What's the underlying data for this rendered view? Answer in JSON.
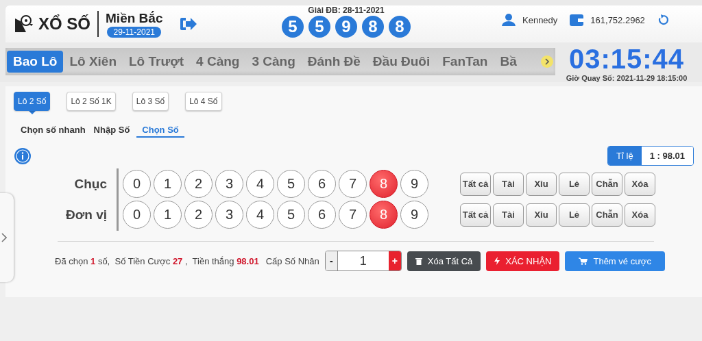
{
  "header": {
    "logo": "XỔ SỐ",
    "region": "Miền Bắc",
    "date": "29-11-2021",
    "jackpot_label": "Giải ĐB: 28-11-2021",
    "jackpot_digits": [
      "5",
      "5",
      "9",
      "8",
      "8"
    ],
    "user": "Kennedy",
    "balance": "161,752.2962"
  },
  "tabs": [
    {
      "label": "Bao Lô",
      "selected": true
    },
    {
      "label": "Lô Xiên",
      "selected": false
    },
    {
      "label": "Lô Trượt",
      "selected": false
    },
    {
      "label": "4 Càng",
      "selected": false
    },
    {
      "label": "3 Càng",
      "selected": false
    },
    {
      "label": "Đánh Đề",
      "selected": false
    },
    {
      "label": "Đầu Đuôi",
      "selected": false
    },
    {
      "label": "FanTan",
      "selected": false
    },
    {
      "label": "Bầ",
      "selected": false
    }
  ],
  "countdown": {
    "time": "03:15:44",
    "draw_time": "Giờ Quay Số: 2021-11-29 18:15:00"
  },
  "bet_types": [
    {
      "label": "Lô 2 Số",
      "selected": true
    },
    {
      "label": "Lô 2 Số 1K",
      "selected": false
    },
    {
      "label": "Lô 3 Số",
      "selected": false
    },
    {
      "label": "Lô 4 Số",
      "selected": false
    }
  ],
  "modes": [
    {
      "label": "Chọn số nhanh",
      "selected": false
    },
    {
      "label": "Nhập Số",
      "selected": false
    },
    {
      "label": "Chọn Số",
      "selected": true
    }
  ],
  "odds": {
    "label": "Tỉ lệ",
    "value": "1 : 98.01"
  },
  "rows": [
    {
      "label": "Chục",
      "digits": [
        {
          "n": "0",
          "selected": false
        },
        {
          "n": "1",
          "selected": false
        },
        {
          "n": "2",
          "selected": false
        },
        {
          "n": "3",
          "selected": false
        },
        {
          "n": "4",
          "selected": false
        },
        {
          "n": "5",
          "selected": false
        },
        {
          "n": "6",
          "selected": false
        },
        {
          "n": "7",
          "selected": false
        },
        {
          "n": "8",
          "selected": true
        },
        {
          "n": "9",
          "selected": false
        }
      ],
      "quick": [
        "Tất cả",
        "Tài",
        "Xỉu",
        "Lẻ",
        "Chẵn",
        "Xóa"
      ]
    },
    {
      "label": "Đơn vị",
      "digits": [
        {
          "n": "0",
          "selected": false
        },
        {
          "n": "1",
          "selected": false
        },
        {
          "n": "2",
          "selected": false
        },
        {
          "n": "3",
          "selected": false
        },
        {
          "n": "4",
          "selected": false
        },
        {
          "n": "5",
          "selected": false
        },
        {
          "n": "6",
          "selected": false
        },
        {
          "n": "7",
          "selected": false
        },
        {
          "n": "8",
          "selected": true
        },
        {
          "n": "9",
          "selected": false
        }
      ],
      "quick": [
        "Tất cả",
        "Tài",
        "Xỉu",
        "Lẻ",
        "Chẵn",
        "Xóa"
      ]
    }
  ],
  "summary": "Đã chọn **1** số,  Số Tiền Cược **27** ,  Tiền thắng **98.01**",
  "multiplier": {
    "label": "Cấp Số Nhân",
    "minus": "-",
    "value": "1",
    "plus": "+"
  },
  "actions": [
    {
      "kind": "clear",
      "label": "Xóa Tất Cả"
    },
    {
      "kind": "confirm",
      "label": "XÁC NHẬN"
    },
    {
      "kind": "add",
      "label": "Thêm vé cược"
    }
  ]
}
